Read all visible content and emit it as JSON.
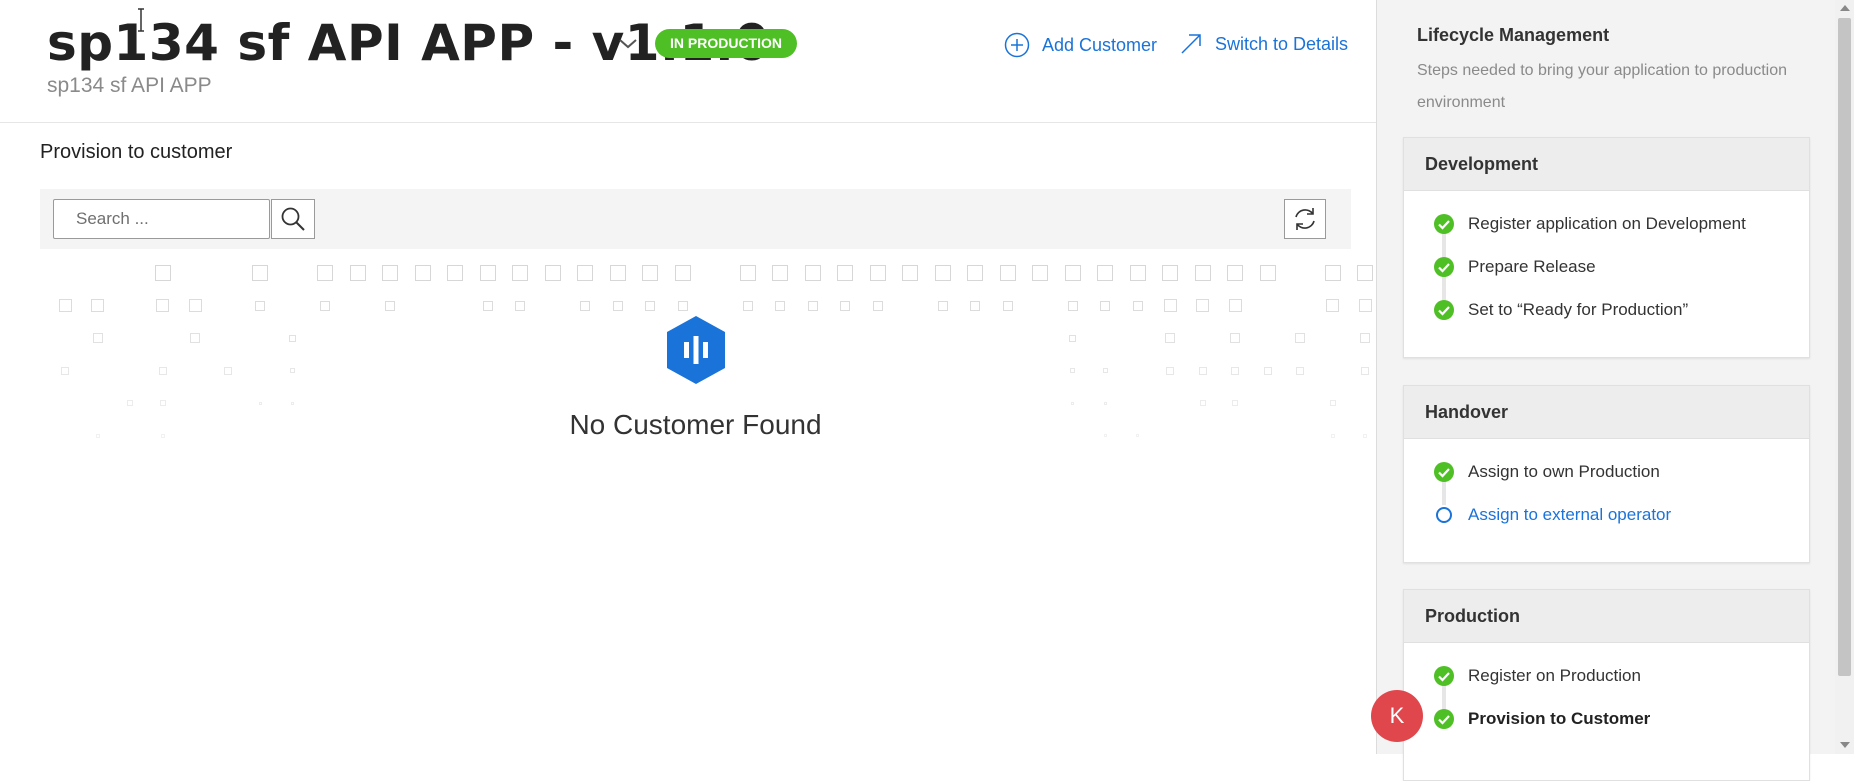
{
  "header": {
    "title": "sp134 sf API APP - v1.1.0",
    "subtitle": "sp134 sf API APP",
    "status_badge": "IN PRODUCTION",
    "add_customer": "Add Customer",
    "switch_details": "Switch to Details"
  },
  "main": {
    "section_title": "Provision to customer",
    "search_placeholder": "Search ...",
    "empty_message": "No Customer Found"
  },
  "sidebar": {
    "title": "Lifecycle Management",
    "description": "Steps needed to bring your application to production environment",
    "groups": [
      {
        "title": "Development",
        "steps": [
          {
            "label": "Register application on Development",
            "status": "done"
          },
          {
            "label": "Prepare Release",
            "status": "done"
          },
          {
            "label": "Set to “Ready for Production”",
            "status": "done"
          }
        ]
      },
      {
        "title": "Handover",
        "steps": [
          {
            "label": "Assign to own Production",
            "status": "done"
          },
          {
            "label": "Assign to external operator",
            "status": "pending"
          }
        ]
      },
      {
        "title": "Production",
        "steps": [
          {
            "label": "Register on Production",
            "status": "done"
          },
          {
            "label": "Provision to Customer",
            "status": "current"
          }
        ]
      }
    ]
  },
  "avatar": {
    "initial": "K"
  },
  "colors": {
    "accent": "#1a73d9",
    "success": "#4fbf26",
    "avatar": "#e0474c"
  },
  "icons": {
    "dropdown": "chevron-down-icon",
    "add": "plus-circle-icon",
    "switch": "arrow-up-right-icon",
    "search": "search-icon",
    "refresh": "refresh-icon",
    "empty": "empty-state-hexagon-icon",
    "done": "check-circle-icon",
    "pending": "circle-outline-icon"
  }
}
